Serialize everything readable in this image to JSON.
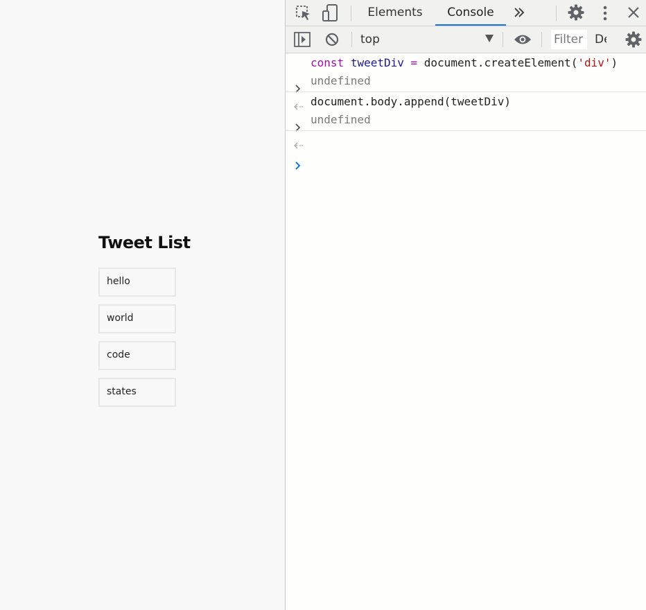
{
  "page": {
    "title": "Tweet List",
    "tweets": [
      "hello",
      "world",
      "code",
      "states"
    ]
  },
  "devtools": {
    "tabs": {
      "elements": "Elements",
      "console": "Console"
    },
    "toolbar": {
      "context": "top",
      "filter_placeholder": "Filter",
      "levels_label": "Default levels"
    },
    "console": {
      "entries": [
        {
          "input_parts": {
            "keyword": "const",
            "space1": " ",
            "variable": "tweetDiv",
            "op": " = ",
            "call": "document.createElement(",
            "string": "'div'",
            "close": ")"
          },
          "result": "undefined"
        },
        {
          "input": "document.body.append(tweetDiv)",
          "result": "undefined"
        }
      ]
    },
    "icons": {
      "inspect": "inspect-element-icon",
      "device": "device-toolbar-icon",
      "more_tabs": "chevron-double-right-icon",
      "settings": "gear-icon",
      "menu": "kebab-menu-icon",
      "close": "close-icon",
      "sidebar": "sidebar-toggle-icon",
      "clear": "clear-console-icon",
      "eye": "eye-icon",
      "console_settings": "gear-icon"
    },
    "colors": {
      "accent": "#1a73e8",
      "keyword": "#a10da9",
      "variable": "#1b1a8f",
      "string": "#b01414"
    }
  }
}
